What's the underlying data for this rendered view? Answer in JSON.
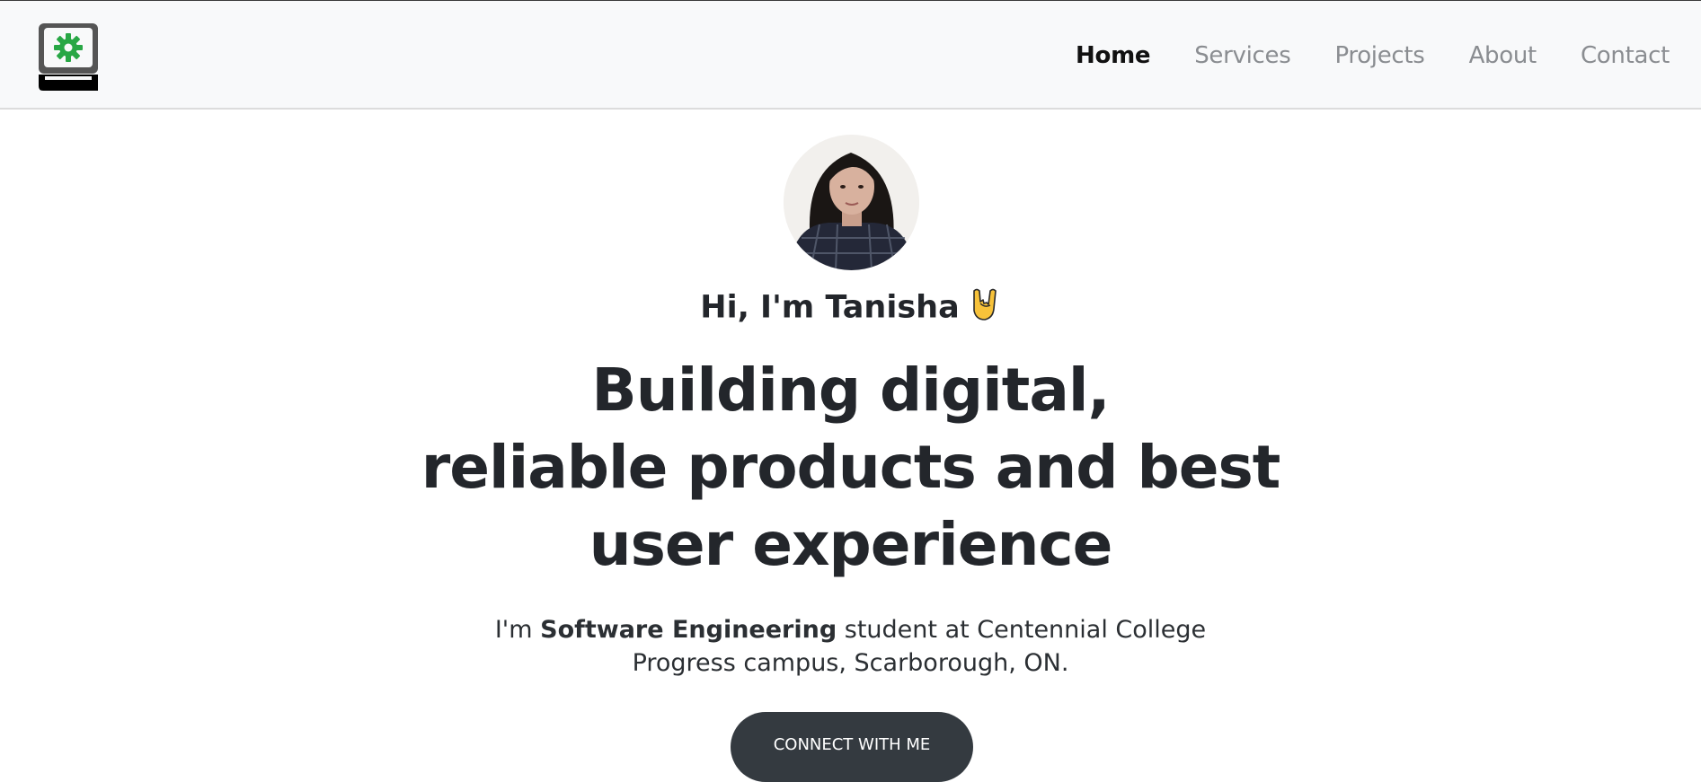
{
  "header": {
    "logo_icon": "laptop-gear-icon",
    "nav": [
      {
        "label": "Home",
        "active": true
      },
      {
        "label": "Services",
        "active": false
      },
      {
        "label": "Projects",
        "active": false
      },
      {
        "label": "About",
        "active": false
      },
      {
        "label": "Contact",
        "active": false
      }
    ]
  },
  "hero": {
    "avatar": "profile-photo",
    "greeting": "Hi, I'm Tanisha",
    "greeting_icon": "rock-on-hand-icon",
    "headline_lines": [
      "Building digital,",
      "reliable products and best",
      "user experience"
    ],
    "bio_prefix": "I'm ",
    "bio_bold": "Software Engineering",
    "bio_line1_suffix": " student at Centennial College",
    "bio_line2": "Progress campus, Scarborough, ON.",
    "cta_label": "CONNECT WITH ME"
  },
  "colors": {
    "navbar_bg": "#f8f9fa",
    "logo_accent": "#28a745",
    "button_bg": "#343a40",
    "text_dark": "#23262b"
  }
}
